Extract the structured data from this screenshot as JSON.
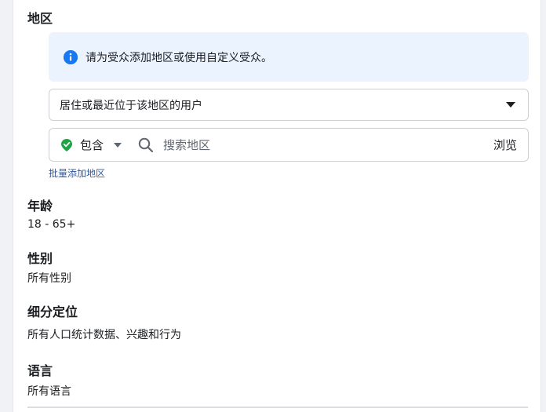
{
  "location": {
    "title": "地区",
    "info_text": "请为受众添加地区或使用自定义受众。",
    "dropdown_value": "居住或最近位于该地区的用户",
    "include_label": "包含",
    "search_placeholder": "搜索地区",
    "browse_label": "浏览",
    "bulk_add_label": "批量添加地区"
  },
  "age": {
    "title": "年龄",
    "value": "18 - 65+"
  },
  "gender": {
    "title": "性别",
    "value": "所有性别"
  },
  "detailed_targeting": {
    "title": "细分定位",
    "value": "所有人口统计数据、兴趣和行为"
  },
  "language": {
    "title": "语言",
    "value": "所有语言"
  },
  "colors": {
    "info_bg": "#ebf3ff",
    "info_icon": "#1877f2",
    "include_pin": "#1ea446",
    "link": "#385898"
  }
}
